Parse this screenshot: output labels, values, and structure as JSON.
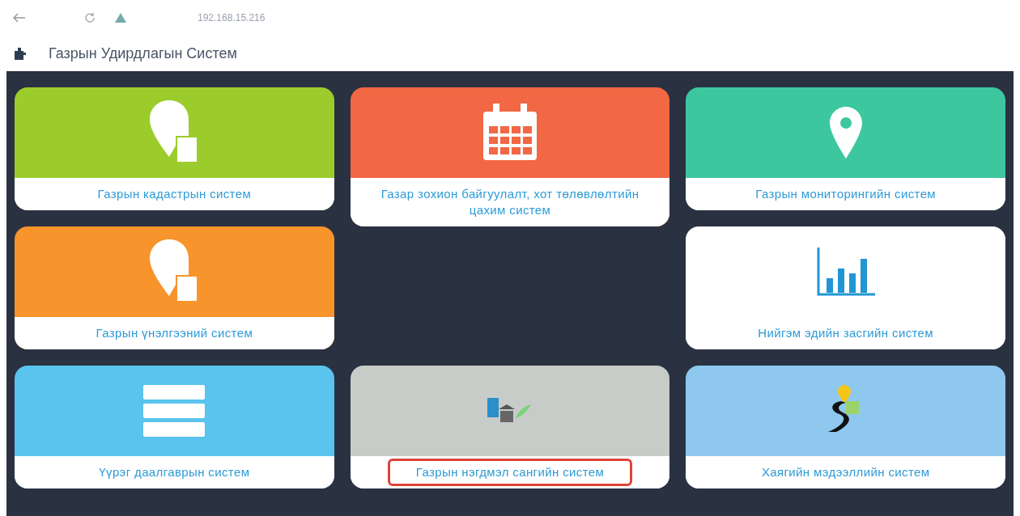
{
  "browser": {
    "url": "192.168.15.216"
  },
  "app": {
    "title": "Газрын Удирдлагын Систем"
  },
  "tiles": [
    {
      "label": "Газрын кадастрын систем",
      "color": "#9ccc2c",
      "kind": "pin-doc",
      "highlighted": false
    },
    {
      "label": "Газар зохион байгуулалт, хот төлөвлөлтийн цахим систем",
      "color": "#f26744",
      "kind": "calendar",
      "highlighted": false
    },
    {
      "label": "Газрын мониторингийн систем",
      "color": "#3cc79f",
      "kind": "pin",
      "highlighted": false
    },
    {
      "label": "Газрын үнэлгээний систем",
      "color": "#f7942c",
      "kind": "pin-calc",
      "highlighted": false
    },
    {
      "kind": "empty"
    },
    {
      "label": "Нийгэм эдийн засгийн систем",
      "color": "#ffffff",
      "kind": "chart",
      "highlighted": false
    },
    {
      "label": "Үүрэг даалгаврын систем",
      "color": "#5ac3ee",
      "kind": "server",
      "highlighted": false
    },
    {
      "label": "Газрын нэгдмэл сангийн систем",
      "color": "#c8ccc8",
      "kind": "fund",
      "highlighted": true
    },
    {
      "label": "Хаягийн мэдээллийн систем",
      "color": "#8ec8ee",
      "kind": "road",
      "highlighted": false
    }
  ]
}
